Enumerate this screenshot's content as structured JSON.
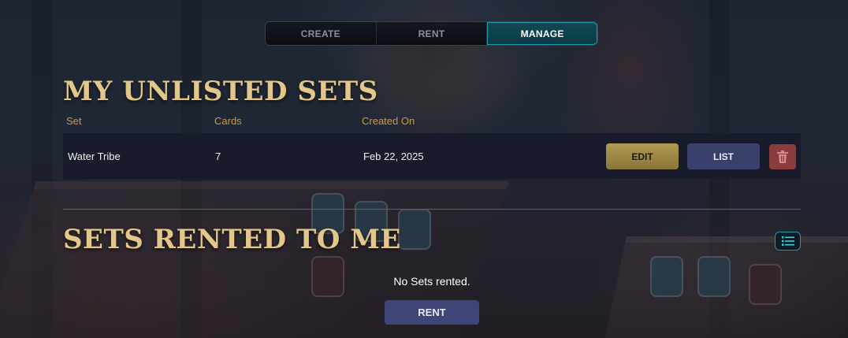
{
  "tabs": [
    {
      "label": "CREATE",
      "active": false
    },
    {
      "label": "RENT",
      "active": false
    },
    {
      "label": "MANAGE",
      "active": true
    }
  ],
  "unlisted": {
    "title": "MY UNLISTED SETS",
    "columns": [
      "Set",
      "Cards",
      "Created On"
    ],
    "rows": [
      {
        "set": "Water Tribe",
        "cards": "7",
        "created_on": "Feb 22, 2025"
      }
    ],
    "edit_label": "EDIT",
    "list_label": "LIST"
  },
  "rented": {
    "title": "SETS RENTED TO ME",
    "empty_text": "No Sets rented.",
    "rent_label": "RENT"
  },
  "colors": {
    "accent_gold": "#e3c68a",
    "active_tab": "#0f4a55",
    "delete": "#8a3c3c",
    "list_button": "#3a3f6b"
  },
  "icons": {
    "delete": "trash-icon",
    "view_toggle": "list-view-icon"
  }
}
